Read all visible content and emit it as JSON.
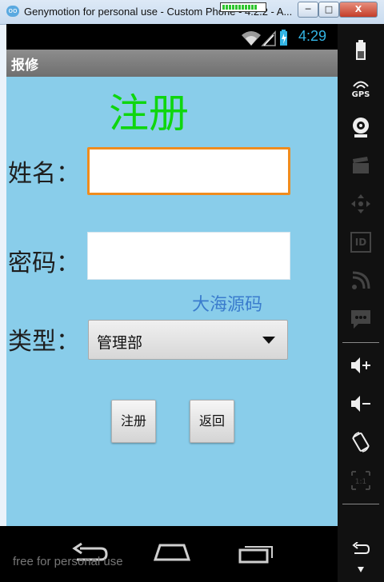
{
  "window": {
    "title": "Genymotion for personal use - Custom Phone - 4.2.2 - A...",
    "progress": 0.85,
    "buttons": {
      "minimize": "─",
      "maximize": "□",
      "close": "X"
    }
  },
  "status_bar": {
    "time": "4:29",
    "time_color": "#33b5e5"
  },
  "action_bar": {
    "title": "报修"
  },
  "form": {
    "heading": "注册",
    "heading_color": "#0fd60f",
    "name_label": "姓名：",
    "name_value": "",
    "password_label": "密码：",
    "password_value": "",
    "type_label": "类型：",
    "type_selected": "管理部",
    "watermark": "大海源码",
    "register_button": "注册",
    "back_button": "返回"
  },
  "nav_bar": {
    "free_text": "free for personal use",
    "icons": [
      "back-icon",
      "home-icon",
      "recent-apps-icon"
    ]
  },
  "side_panel": {
    "icons": [
      "battery-icon",
      "gps-icon",
      "camera-icon",
      "video-capture-icon",
      "remote-control-icon",
      "id-icon",
      "network-icon",
      "sms-icon",
      "volume-up-icon",
      "volume-down-icon",
      "rotate-icon",
      "pixel-perfect-icon",
      "back-icon",
      "menu-dots-icon"
    ],
    "gps_label": "GPS",
    "id_label": "ID",
    "scale_label": "1:1"
  },
  "colors": {
    "screen_bg": "#89cdea",
    "focus_border": "#f08c1e",
    "watermark": "#3a7ccd"
  }
}
